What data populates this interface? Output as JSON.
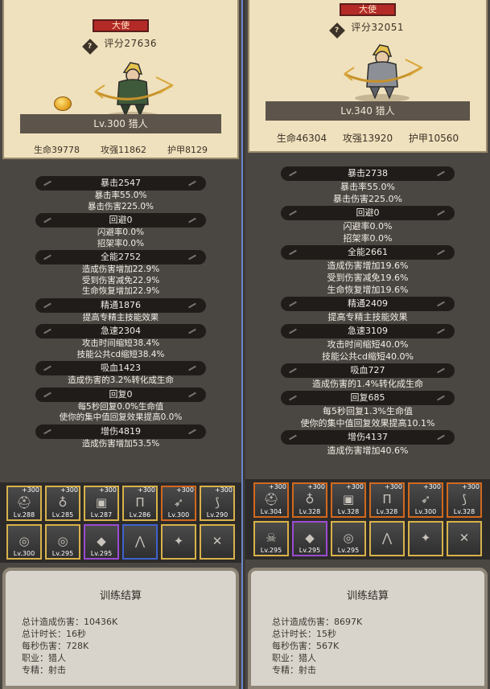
{
  "left": {
    "title": "大使",
    "score": "评分27636",
    "level": "Lv.300 猎人",
    "stats": [
      "生命39778",
      "攻强11862",
      "护甲8129"
    ],
    "attrs": [
      {
        "head": "暴击2547",
        "lines": [
          "暴击率55.0%",
          "暴击伤害225.0%"
        ]
      },
      {
        "head": "回避0",
        "lines": [
          "闪避率0.0%",
          "招架率0.0%"
        ]
      },
      {
        "head": "全能2752",
        "lines": [
          "造成伤害增加22.9%",
          "受到伤害减免22.9%",
          "生命恢复增加22.9%"
        ]
      },
      {
        "head": "精通1876",
        "lines": [
          "提高专精主技能效果"
        ]
      },
      {
        "head": "急速2304",
        "lines": [
          "攻击时间缩短38.4%",
          "技能公共cd缩短38.4%"
        ]
      },
      {
        "head": "吸血1423",
        "lines": [
          "造成伤害的3.2%转化成生命"
        ]
      },
      {
        "head": "回复0",
        "lines": [
          "每5秒回复0.0%生命值",
          "使你的集中值回复效果提高0.0%"
        ]
      },
      {
        "head": "增伤4819",
        "lines": [
          "造成伤害增加53.5%"
        ]
      }
    ],
    "equip": [
      {
        "plus": "+300",
        "lv": "Lv.288",
        "rarity": "gold",
        "icon": "helmet-icon"
      },
      {
        "plus": "+300",
        "lv": "Lv.285",
        "rarity": "gold",
        "icon": "necklace-icon"
      },
      {
        "plus": "+300",
        "lv": "Lv.287",
        "rarity": "gold",
        "icon": "armor-icon"
      },
      {
        "plus": "+300",
        "lv": "Lv.286",
        "rarity": "gold",
        "icon": "legs-icon"
      },
      {
        "plus": "+300",
        "lv": "Lv.300",
        "rarity": "orange",
        "icon": "arrow-icon"
      },
      {
        "plus": "+300",
        "lv": "Lv.290",
        "rarity": "gold",
        "icon": "bow-icon"
      },
      {
        "plus": "",
        "lv": "Lv.300",
        "rarity": "gold",
        "icon": "ring-icon"
      },
      {
        "plus": "",
        "lv": "Lv.295",
        "rarity": "gold",
        "icon": "ring-icon"
      },
      {
        "plus": "",
        "lv": "Lv.295",
        "rarity": "purple",
        "icon": "gem-icon"
      },
      {
        "plus": "",
        "lv": "",
        "rarity": "blue",
        "icon": "cloak-icon"
      },
      {
        "plus": "",
        "lv": "",
        "rarity": "gold",
        "icon": "shuriken-icon"
      },
      {
        "plus": "",
        "lv": "",
        "rarity": "gold",
        "icon": "crossbow-icon"
      }
    ],
    "result": {
      "title": "训练结算",
      "lines": [
        "总计造成伤害：10436K",
        "总计时长：16秒",
        "每秒伤害：728K",
        "职业：猎人",
        "专精：射击"
      ]
    }
  },
  "right": {
    "title": "大使",
    "score": "评分32051",
    "level": "Lv.340 猎人",
    "stats": [
      "生命46304",
      "攻强13920",
      "护甲10560"
    ],
    "attrs": [
      {
        "head": "暴击2738",
        "lines": [
          "暴击率55.0%",
          "暴击伤害225.0%"
        ]
      },
      {
        "head": "回避0",
        "lines": [
          "闪避率0.0%",
          "招架率0.0%"
        ]
      },
      {
        "head": "全能2661",
        "lines": [
          "造成伤害增加19.6%",
          "受到伤害减免19.6%",
          "生命恢复增加19.6%"
        ]
      },
      {
        "head": "精通2409",
        "lines": [
          "提高专精主技能效果"
        ]
      },
      {
        "head": "急速3109",
        "lines": [
          "攻击时间缩短40.0%",
          "技能公共cd缩短40.0%"
        ]
      },
      {
        "head": "吸血727",
        "lines": [
          "造成伤害的1.4%转化成生命"
        ]
      },
      {
        "head": "回复685",
        "lines": [
          "每5秒回复1.3%生命值",
          "使你的集中值回复效果提高10.1%"
        ]
      },
      {
        "head": "增伤4137",
        "lines": [
          "造成伤害增加40.6%"
        ]
      }
    ],
    "equip": [
      {
        "plus": "+300",
        "lv": "Lv.304",
        "rarity": "orange",
        "icon": "helmet-icon"
      },
      {
        "plus": "+300",
        "lv": "Lv.328",
        "rarity": "orange",
        "icon": "necklace-icon"
      },
      {
        "plus": "+300",
        "lv": "Lv.328",
        "rarity": "orange",
        "icon": "armor-icon"
      },
      {
        "plus": "+300",
        "lv": "Lv.328",
        "rarity": "orange",
        "icon": "legs-icon"
      },
      {
        "plus": "+300",
        "lv": "Lv.300",
        "rarity": "orange",
        "icon": "arrow-icon"
      },
      {
        "plus": "+300",
        "lv": "Lv.328",
        "rarity": "orange",
        "icon": "bow-icon"
      },
      {
        "plus": "",
        "lv": "Lv.295",
        "rarity": "gold",
        "icon": "skull-icon"
      },
      {
        "plus": "",
        "lv": "Lv.295",
        "rarity": "purple",
        "icon": "gem-icon"
      },
      {
        "plus": "",
        "lv": "Lv.295",
        "rarity": "gold",
        "icon": "ring-icon"
      },
      {
        "plus": "",
        "lv": "",
        "rarity": "gold",
        "icon": "cloak-icon"
      },
      {
        "plus": "",
        "lv": "",
        "rarity": "gold",
        "icon": "shuriken-icon"
      },
      {
        "plus": "",
        "lv": "",
        "rarity": "gold",
        "icon": "crossbow-icon"
      }
    ],
    "result": {
      "title": "训练结算",
      "lines": [
        "总计造成伤害：8697K",
        "总计时长：15秒",
        "每秒伤害：567K",
        "职业：猎人",
        "专精：射击"
      ]
    }
  }
}
